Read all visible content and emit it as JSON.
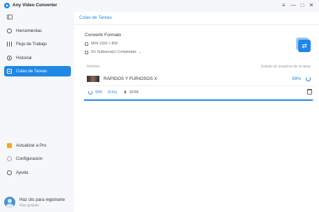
{
  "app": {
    "title": "Any Video Converter"
  },
  "window_controls": {
    "menu": "≡",
    "minimize": "—",
    "maximize": "□",
    "close": "✕"
  },
  "sidebar": {
    "items": [
      {
        "label": "Herramientas",
        "icon": "tools-icon"
      },
      {
        "label": "Flujo de Trabajo",
        "icon": "workflow-icon"
      },
      {
        "label": "Historial",
        "icon": "history-icon"
      },
      {
        "label": "Colas de Tareas",
        "icon": "queue-icon",
        "active": true
      }
    ],
    "bottom_items": [
      {
        "label": "Actualizar a Pro",
        "icon": "upgrade-icon"
      },
      {
        "label": "Configuración",
        "icon": "gear-icon"
      },
      {
        "label": "Ayuda",
        "icon": "help-icon"
      }
    ],
    "user": {
      "name": "Haz clic para registrarte",
      "plan": "Plan gratuito"
    }
  },
  "main": {
    "title": "Colas de Tareas",
    "task": {
      "name": "Convertir Formato",
      "format": "MP4 1920 × 800",
      "status": "0/1 Subtarea(s) Completada",
      "status_chevron": "⌄"
    },
    "columns": {
      "name": "Nombre",
      "progress": "Estado de progreso de la tarea"
    },
    "row": {
      "title": "RAPIDOS Y FURIOSOS X",
      "percent": "99%"
    },
    "subrow": {
      "percent": "99%",
      "speed": "(9.6x)",
      "hourglass": "⧗",
      "time": "15:59"
    },
    "progress": 0.99
  },
  "colors": {
    "accent": "#1e88e5",
    "sidebar_bg": "#f5f7fa"
  }
}
